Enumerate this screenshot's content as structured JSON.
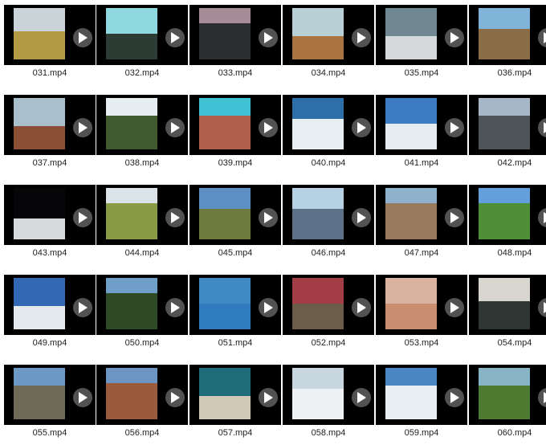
{
  "files": [
    {
      "name": "031.mp4",
      "sky": "#c9d3d8",
      "ground": "#b29a45",
      "horizon": 0.45
    },
    {
      "name": "032.mp4",
      "sky": "#8ed8e0",
      "ground": "#2c3b34",
      "horizon": 0.5
    },
    {
      "name": "033.mp4",
      "sky": "#a58b95",
      "ground": "#2b2d2f",
      "horizon": 0.3
    },
    {
      "name": "034.mp4",
      "sky": "#b9cfd6",
      "ground": "#a9743f",
      "horizon": 0.55
    },
    {
      "name": "035.mp4",
      "sky": "#6f8790",
      "ground": "#d5d9dc",
      "horizon": 0.55
    },
    {
      "name": "036.mp4",
      "sky": "#7fb3d8",
      "ground": "#8a6c46",
      "horizon": 0.4
    },
    {
      "name": "037.mp4",
      "sky": "#a9bfcc",
      "ground": "#8a4f35",
      "horizon": 0.55
    },
    {
      "name": "038.mp4",
      "sky": "#e7eef2",
      "ground": "#3f5b2f",
      "horizon": 0.35
    },
    {
      "name": "039.mp4",
      "sky": "#3fc2d4",
      "ground": "#b15f4d",
      "horizon": 0.35
    },
    {
      "name": "040.mp4",
      "sky": "#2d6fa8",
      "ground": "#e8eef2",
      "horizon": 0.4
    },
    {
      "name": "041.mp4",
      "sky": "#3c7cc2",
      "ground": "#e6ecf0",
      "horizon": 0.5
    },
    {
      "name": "042.mp4",
      "sky": "#a6b7c7",
      "ground": "#4f5458",
      "horizon": 0.35
    },
    {
      "name": "043.mp4",
      "sky": "#060608",
      "ground": "#d7d9dc",
      "horizon": 0.6
    },
    {
      "name": "044.mp4",
      "sky": "#d9e3e8",
      "ground": "#8a9b45",
      "horizon": 0.3
    },
    {
      "name": "045.mp4",
      "sky": "#5d8fc4",
      "ground": "#6f7a3e",
      "horizon": 0.4
    },
    {
      "name": "046.mp4",
      "sky": "#b7d1e4",
      "ground": "#5d7288",
      "horizon": 0.4
    },
    {
      "name": "047.mp4",
      "sky": "#8fb2cc",
      "ground": "#9a7a5c",
      "horizon": 0.3
    },
    {
      "name": "048.mp4",
      "sky": "#63a0db",
      "ground": "#4f8f35",
      "horizon": 0.3
    },
    {
      "name": "049.mp4",
      "sky": "#3368b4",
      "ground": "#e4e9ee",
      "horizon": 0.55
    },
    {
      "name": "050.mp4",
      "sky": "#6f9fc9",
      "ground": "#2e4a25",
      "horizon": 0.3
    },
    {
      "name": "051.mp4",
      "sky": "#3f8ac5",
      "ground": "#2f7bbd",
      "horizon": 0.5
    },
    {
      "name": "052.mp4",
      "sky": "#a33d46",
      "ground": "#6b5d4a",
      "horizon": 0.5
    },
    {
      "name": "053.mp4",
      "sky": "#d9b3a0",
      "ground": "#c88e6f",
      "horizon": 0.5
    },
    {
      "name": "054.mp4",
      "sky": "#d8d6ce",
      "ground": "#2e3634",
      "horizon": 0.45
    },
    {
      "name": "055.mp4",
      "sky": "#6d99c6",
      "ground": "#6f6a58",
      "horizon": 0.35
    },
    {
      "name": "056.mp4",
      "sky": "#6c95c4",
      "ground": "#9a5a3b",
      "horizon": 0.3
    },
    {
      "name": "057.mp4",
      "sky": "#1f6d7a",
      "ground": "#d1c9b8",
      "horizon": 0.55
    },
    {
      "name": "058.mp4",
      "sky": "#c8d6e0",
      "ground": "#eef1f3",
      "horizon": 0.4
    },
    {
      "name": "059.mp4",
      "sky": "#4a86c4",
      "ground": "#e9eef2",
      "horizon": 0.35
    },
    {
      "name": "060.mp4",
      "sky": "#89b4c6",
      "ground": "#4e7a32",
      "horizon": 0.35
    }
  ]
}
